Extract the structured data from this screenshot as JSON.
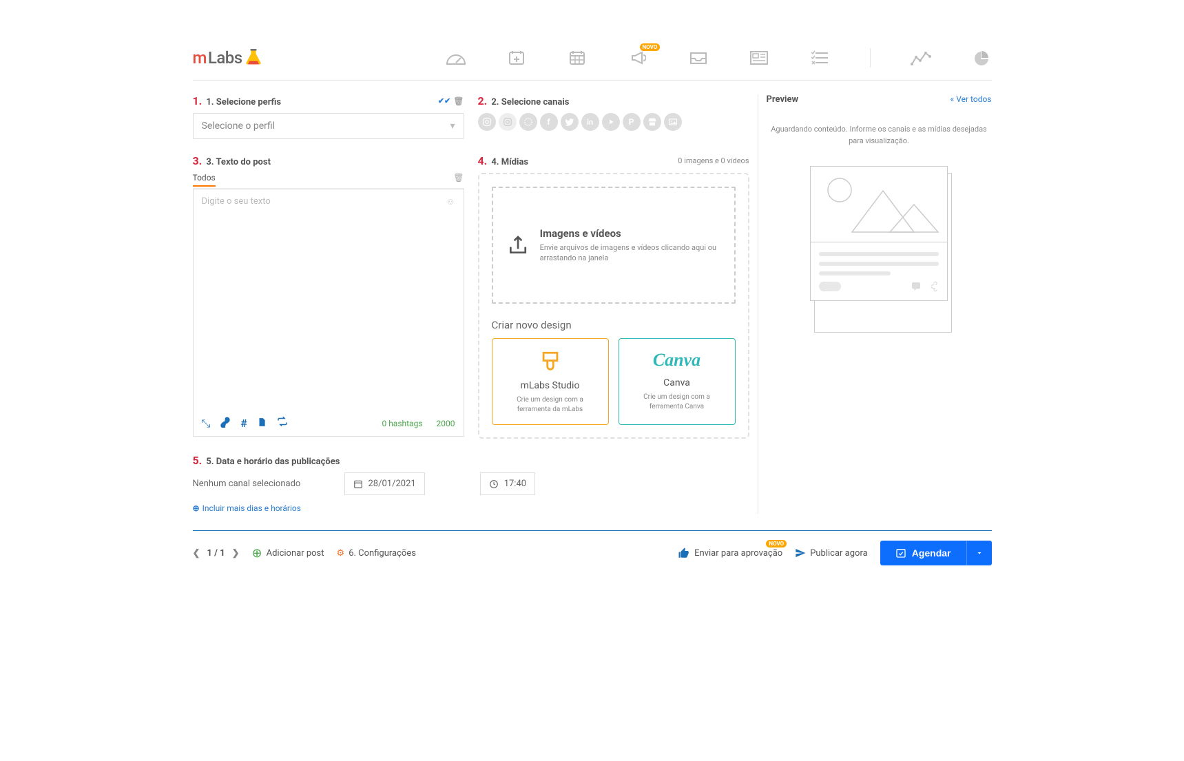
{
  "annotations": {
    "n1": "1.",
    "n2": "2.",
    "n3": "3.",
    "n4": "4.",
    "n5": "5."
  },
  "logo": {
    "m": "m",
    "labs": "Labs"
  },
  "nav": {
    "novo_badge": "NOVO"
  },
  "profiles": {
    "header": "1. Selecione perfis",
    "placeholder": "Selecione o perfil"
  },
  "channels": {
    "header": "2. Selecione canais"
  },
  "postText": {
    "header": "3. Texto do post",
    "tab": "Todos",
    "placeholder": "Digite o seu texto",
    "hashtags": "0 hashtags",
    "limit": "2000"
  },
  "media": {
    "header": "4. Mídias",
    "count": "0 imagens e 0 vídeos",
    "upload_title": "Imagens e vídeos",
    "upload_desc": "Envie arquivos de imagens e vídeos clicando aqui ou arrastando na janela",
    "design_header": "Criar novo design",
    "mlabs_title": "mLabs Studio",
    "mlabs_desc": "Crie um design com a ferramenta da mLabs",
    "canva_logo": "Canva",
    "canva_title": "Canva",
    "canva_desc": "Crie um design com a ferramenta Canva"
  },
  "schedule": {
    "header": "5. Data e horário das publicações",
    "no_channel": "Nenhum canal selecionado",
    "date": "28/01/2021",
    "time": "17:40",
    "add_more": "Incluir mais dias e horários"
  },
  "preview": {
    "header": "Preview",
    "see_all": "Ver todos",
    "waiting": "Aguardando conteúdo. Informe os canais e as mídias desejadas para visualização."
  },
  "footer": {
    "page": "1 / 1",
    "add_post": "Adicionar post",
    "config": "6. Configurações",
    "send_approval": "Enviar para aprovação",
    "publish_now": "Publicar agora",
    "schedule_btn": "Agendar",
    "novo_badge": "NOVO"
  }
}
